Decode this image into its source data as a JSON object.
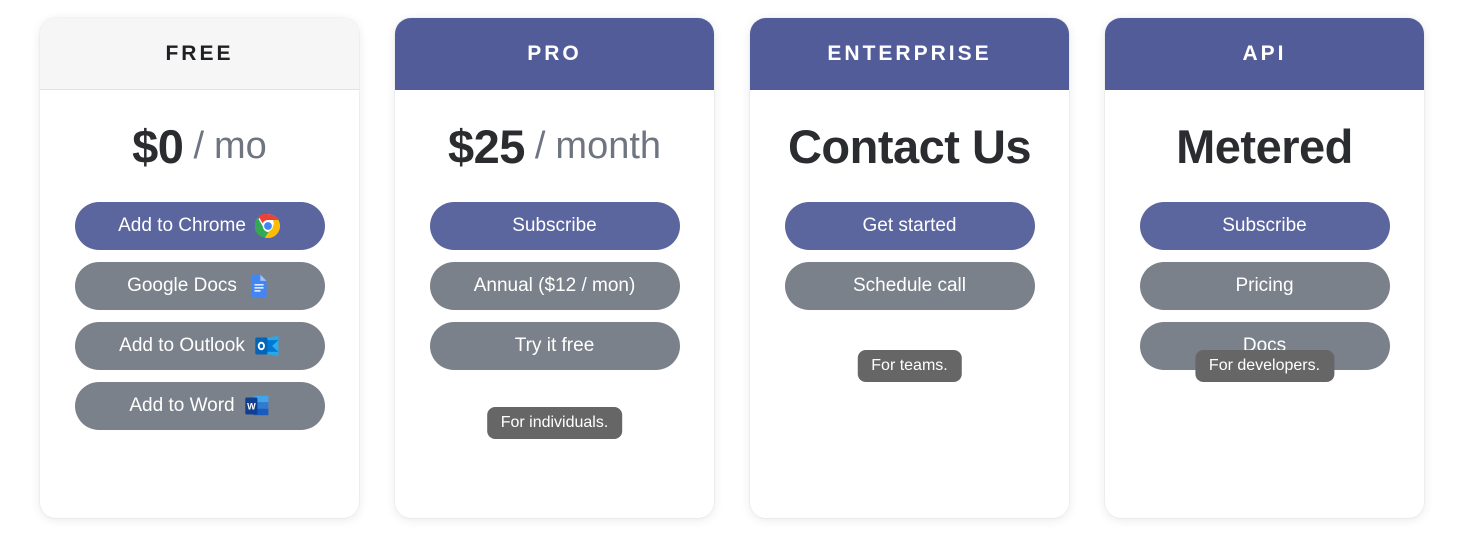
{
  "cards": [
    {
      "id": "free",
      "header": "FREE",
      "theme": "light",
      "price": {
        "amount": "$0",
        "separator": "/",
        "period": "mo"
      },
      "buttons": [
        {
          "label": "Add to Chrome",
          "style": "primary",
          "icon": "chrome-icon"
        },
        {
          "label": "Google Docs",
          "style": "secondary",
          "icon": "google-docs-icon"
        },
        {
          "label": "Add to Outlook",
          "style": "secondary",
          "icon": "outlook-icon"
        },
        {
          "label": "Add to Word",
          "style": "secondary",
          "icon": "word-icon"
        }
      ],
      "tooltip": ""
    },
    {
      "id": "pro",
      "header": "PRO",
      "theme": "accent",
      "price": {
        "amount": "$25",
        "separator": "/",
        "period": "month"
      },
      "buttons": [
        {
          "label": "Subscribe",
          "style": "primary",
          "icon": ""
        },
        {
          "label": "Annual ($12 / mon)",
          "style": "secondary",
          "icon": ""
        },
        {
          "label": "Try it free",
          "style": "secondary",
          "icon": ""
        }
      ],
      "tooltip": "For individuals."
    },
    {
      "id": "enterprise",
      "header": "ENTERPRISE",
      "theme": "accent",
      "price": {
        "amount": "Contact Us",
        "separator": "",
        "period": ""
      },
      "buttons": [
        {
          "label": "Get started",
          "style": "primary",
          "icon": ""
        },
        {
          "label": "Schedule call",
          "style": "secondary",
          "icon": ""
        }
      ],
      "tooltip": "For teams."
    },
    {
      "id": "api",
      "header": "API",
      "theme": "accent",
      "price": {
        "amount": "Metered",
        "separator": "",
        "period": ""
      },
      "buttons": [
        {
          "label": "Subscribe",
          "style": "primary",
          "icon": ""
        },
        {
          "label": "Pricing",
          "style": "secondary",
          "icon": ""
        },
        {
          "label": "Docs",
          "style": "secondary",
          "icon": ""
        }
      ],
      "tooltip": "For developers."
    }
  ],
  "colors": {
    "accent": "#525c99",
    "primary_button": "#5b659e",
    "secondary_button": "#7b818a",
    "tooltip_background": "#666666",
    "light_header": "#f6f6f7",
    "price_text": "#2b2c30",
    "price_muted": "#6f7580"
  }
}
